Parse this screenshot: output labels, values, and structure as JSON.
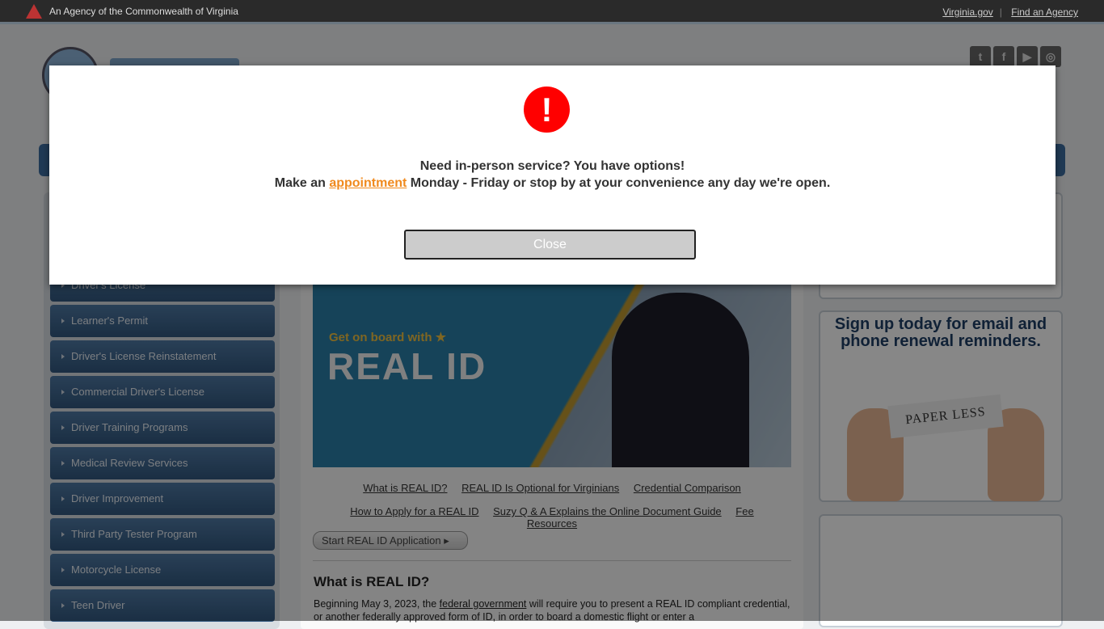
{
  "topbar": {
    "agency": "An Agency of the Commonwealth of Virginia",
    "links": [
      "Virginia.gov",
      "Find an Agency"
    ]
  },
  "social": [
    {
      "icon": "twitter-icon",
      "glyph": "t"
    },
    {
      "icon": "facebook-icon",
      "glyph": "f"
    },
    {
      "icon": "youtube-icon",
      "glyph": "▶"
    },
    {
      "icon": "instagram-icon",
      "glyph": "◎"
    }
  ],
  "sidebar": {
    "items": [
      "Driver's License",
      "Learner's Permit",
      "Driver's License Reinstatement",
      "Commercial Driver's License",
      "Driver Training Programs",
      "Medical Review Services",
      "Driver Improvement",
      "Third Party Tester Program",
      "Motorcycle License",
      "Teen Driver"
    ]
  },
  "main": {
    "hero": {
      "sub": "Get on board with ★",
      "title": "REAL ID"
    },
    "links_row1": [
      "What is REAL ID?",
      "REAL ID Is Optional for Virginians",
      "Credential Comparison"
    ],
    "links_row2": [
      "How to Apply for a REAL ID",
      "Suzy Q & A Explains the Online Document Guide",
      "Fee",
      "Resources"
    ],
    "start_button": "Start REAL ID Application ▸",
    "heading": "What is REAL ID?",
    "para_before": "Beginning May 3, 2023, the ",
    "para_link": "federal government",
    "para_after": " will require you to present a REAL ID compliant credential, or another federally approved form of ID, in order to board a domestic flight or enter a"
  },
  "right": {
    "reminder_title": "Sign up today for email and phone renewal reminders.",
    "paper_text": "PAPER LESS"
  },
  "modal": {
    "icon": "!",
    "line1": "Need in-person service? You have options!",
    "line2_before": "Make an ",
    "line2_link": "appointment",
    "line2_after": " Monday - Friday or stop by at your convenience any day we're open.",
    "close": "Close",
    "colors": {
      "icon": "#ff0000",
      "link": "#f08a1e"
    }
  }
}
